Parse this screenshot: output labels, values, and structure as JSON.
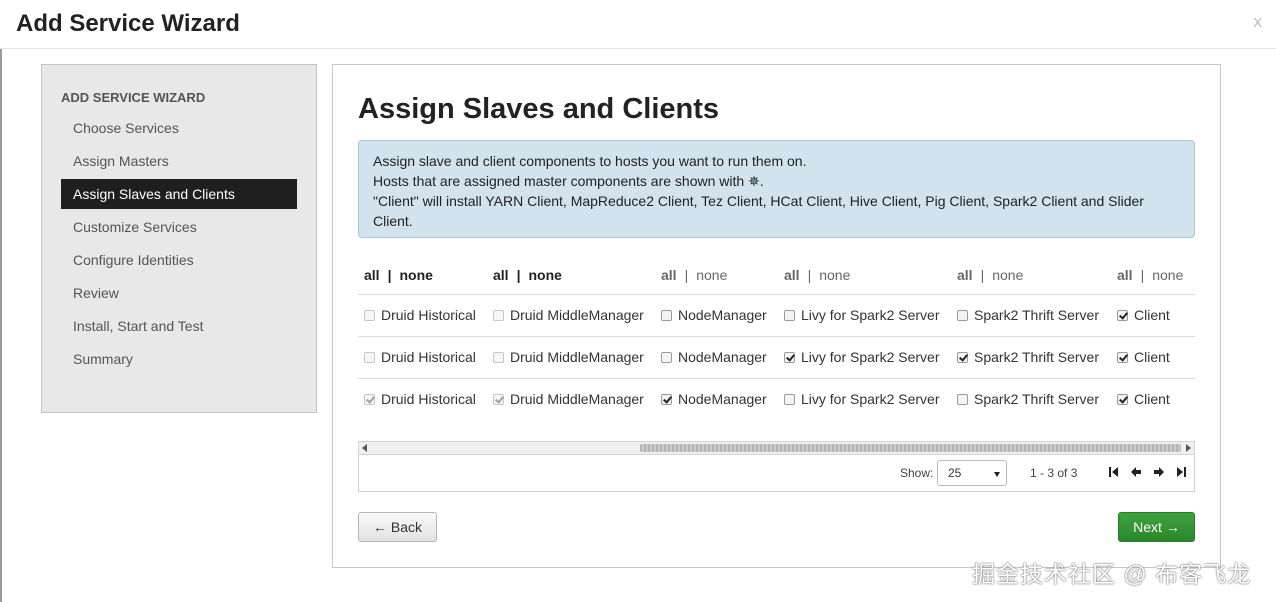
{
  "modal": {
    "title": "Add Service Wizard",
    "close": "x"
  },
  "sidebar": {
    "header": "ADD SERVICE WIZARD",
    "items": [
      {
        "label": "Choose Services"
      },
      {
        "label": "Assign Masters"
      },
      {
        "label": "Assign Slaves and Clients",
        "active": true
      },
      {
        "label": "Customize Services"
      },
      {
        "label": "Configure Identities"
      },
      {
        "label": "Review"
      },
      {
        "label": "Install, Start and Test"
      },
      {
        "label": "Summary"
      }
    ]
  },
  "main": {
    "title": "Assign Slaves and Clients",
    "info_lines": [
      "Assign slave and client components to hosts you want to run them on.",
      "Hosts that are assigned master components are shown with ✵.",
      "\"Client\" will install YARN Client, MapReduce2 Client, Tez Client, HCat Client, Hive Client, Pig Client, Spark2 Client and Slider Client."
    ]
  },
  "table": {
    "all_label": "all",
    "sep": "|",
    "none_label": "none",
    "columns": [
      {
        "component": "Druid Historical",
        "header_style": "dark",
        "disabled": true,
        "checked": [
          false,
          false,
          true
        ]
      },
      {
        "component": "Druid MiddleManager",
        "header_style": "dark",
        "disabled": true,
        "checked": [
          false,
          false,
          true
        ]
      },
      {
        "component": "NodeManager",
        "header_style": "grey",
        "disabled": false,
        "checked": [
          false,
          false,
          true
        ]
      },
      {
        "component": "Livy for Spark2 Server",
        "header_style": "grey",
        "disabled": false,
        "checked": [
          false,
          true,
          false
        ]
      },
      {
        "component": "Spark2 Thrift Server",
        "header_style": "grey",
        "disabled": false,
        "checked": [
          false,
          true,
          false
        ]
      },
      {
        "component": "Client",
        "header_style": "grey",
        "disabled": false,
        "checked": [
          true,
          true,
          true
        ]
      }
    ]
  },
  "pager": {
    "show_label": "Show:",
    "page_size": "25",
    "range": "1 - 3 of 3"
  },
  "buttons": {
    "back": "← Back",
    "next": "Next →"
  },
  "watermark": "掘金技术社区 @ 布客飞龙",
  "colors": {
    "active_nav": "#1f1f1f",
    "info_bg": "#d2e3ee",
    "next_btn": "#2f8f2f"
  }
}
